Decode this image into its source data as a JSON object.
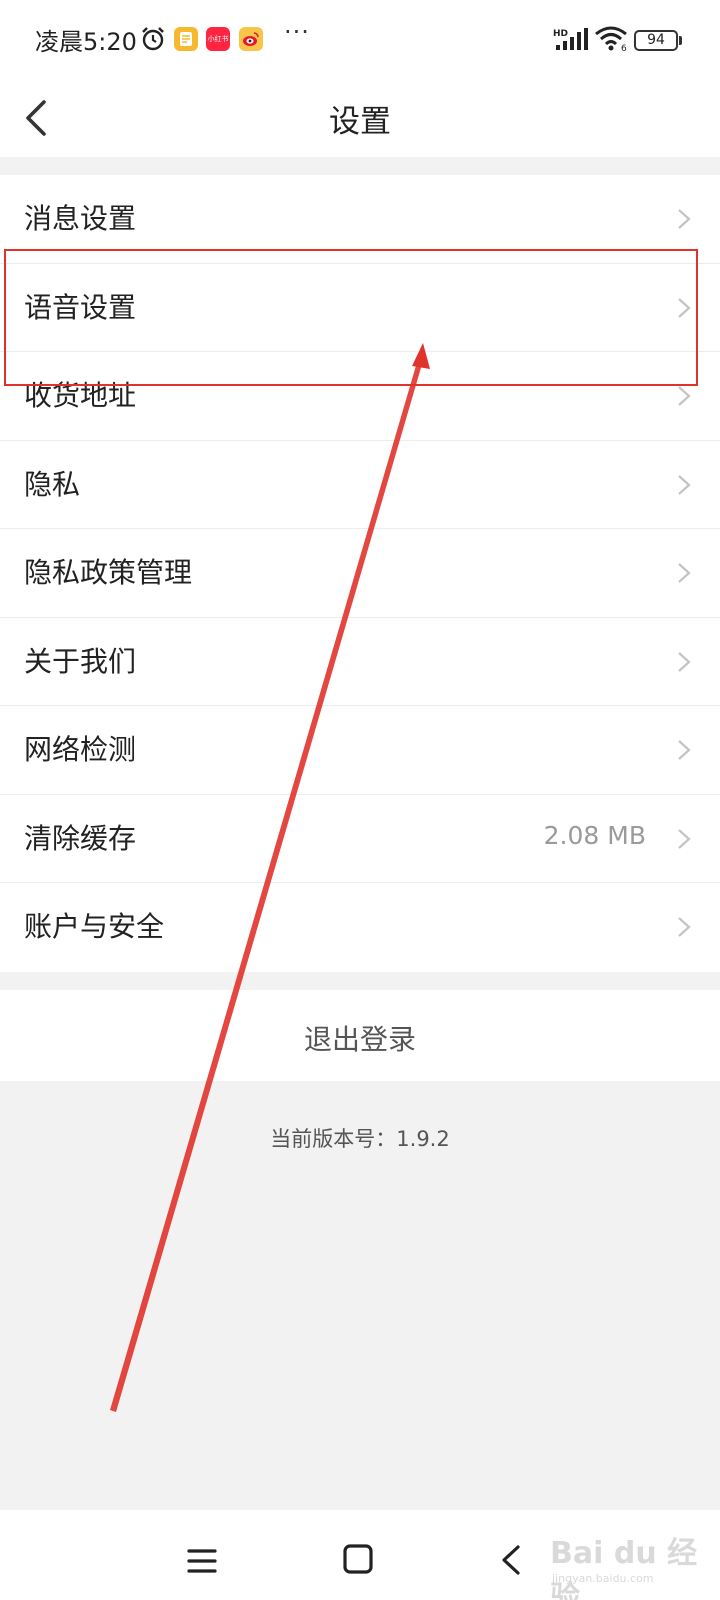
{
  "status_bar": {
    "time": "凌晨5:20",
    "network": "HD",
    "battery_level": "94",
    "battery_percent": 94,
    "app_icons": [
      "notes-app-icon",
      "xiaohongshu-app-icon",
      "weibo-app-icon"
    ],
    "xiaohongshu_label": "小红书",
    "more": "···"
  },
  "header": {
    "title": "设置"
  },
  "menu": {
    "items": [
      {
        "label": "消息设置"
      },
      {
        "label": "语音设置"
      },
      {
        "label": "收货地址"
      },
      {
        "label": "隐私"
      },
      {
        "label": "隐私政策管理"
      },
      {
        "label": "关于我们"
      },
      {
        "label": "网络检测"
      },
      {
        "label": "清除缓存",
        "value": "2.08 MB"
      },
      {
        "label": "账户与安全"
      }
    ]
  },
  "logout": {
    "label": "退出登录"
  },
  "version": {
    "text": "当前版本号：1.9.2"
  },
  "watermark": {
    "brand": "Bai du 经验",
    "url": "jingyan.baidu.com"
  },
  "colors": {
    "annotation": "#e0332b",
    "background": "#f2f2f2",
    "text": "#222222",
    "secondary_text": "#9a9a9a"
  }
}
